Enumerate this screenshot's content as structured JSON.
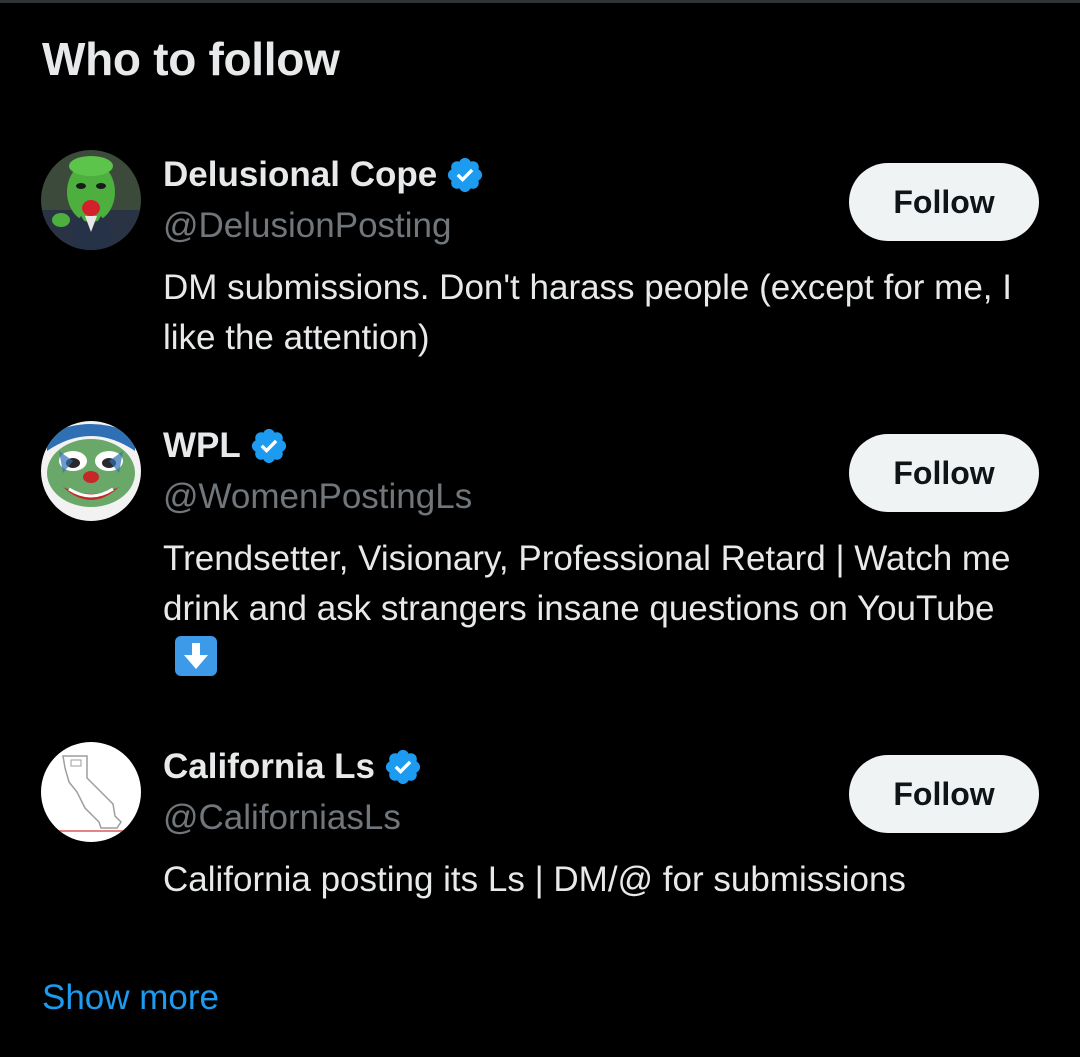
{
  "section": {
    "title": "Who to follow",
    "show_more": "Show more"
  },
  "accounts": [
    {
      "name": "Delusional Cope",
      "handle": "@DelusionPosting",
      "verified": true,
      "bio": "DM submissions. Don't harass people (except for me, I like the attention)",
      "follow_label": "Follow"
    },
    {
      "name": "WPL",
      "handle": "@WomenPostingLs",
      "verified": true,
      "bio": "Trendsetter, Visionary, Professional Retard | Watch me drink and ask strangers insane questions on YouTube",
      "bio_emoji": "down-arrow-emoji",
      "follow_label": "Follow"
    },
    {
      "name": "California Ls",
      "handle": "@CaliforniasLs",
      "verified": true,
      "bio": "California posting its Ls | DM/@ for submissions",
      "follow_label": "Follow"
    }
  ],
  "colors": {
    "background": "#000000",
    "text": "#e7e9ea",
    "secondary_text": "#71767b",
    "accent": "#1d9bf0",
    "button_bg": "#eff3f4",
    "button_text": "#0f1419"
  }
}
